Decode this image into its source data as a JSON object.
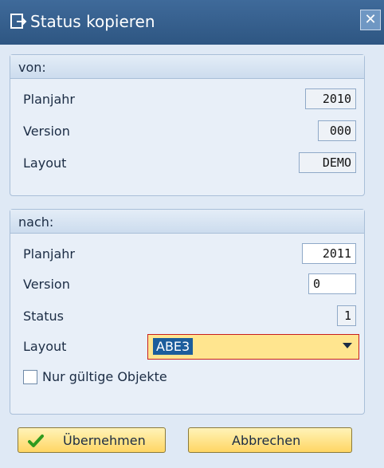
{
  "window": {
    "title": "Status kopieren",
    "close_icon": "close-icon"
  },
  "von": {
    "header": "von:",
    "rows": [
      {
        "label": "Planjahr",
        "value": "2010"
      },
      {
        "label": "Version",
        "value": "000"
      },
      {
        "label": "Layout",
        "value": "DEMO"
      }
    ]
  },
  "nach": {
    "header": "nach:",
    "planjahr": {
      "label": "Planjahr",
      "value": "2011"
    },
    "version": {
      "label": "Version",
      "value": "0"
    },
    "status": {
      "label": "Status",
      "value": "1"
    },
    "layout": {
      "label": "Layout",
      "value": "ABE3"
    },
    "checkbox": {
      "label": "Nur gültige Objekte",
      "checked": false
    }
  },
  "buttons": {
    "ok": "Übernehmen",
    "cancel": "Abbrechen"
  },
  "colors": {
    "titlebar": "#2e5682",
    "panel_bg": "#e8eff8",
    "button_bg": "#ffd664",
    "dropdown_bg": "#ffe58f",
    "selection": "#1c5d9c"
  }
}
